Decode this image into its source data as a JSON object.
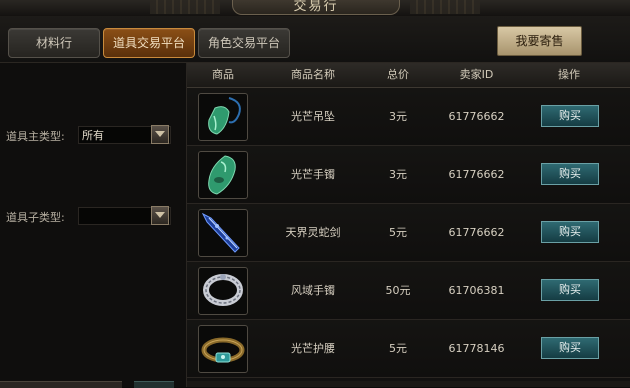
{
  "window": {
    "title": "交易行"
  },
  "tabs": [
    {
      "label": "材料行",
      "active": false
    },
    {
      "label": "道具交易平台",
      "active": true
    },
    {
      "label": "角色交易平台",
      "active": false
    }
  ],
  "sell_button": "我要寄售",
  "filters": {
    "main_type_label": "道具主类型:",
    "main_type_value": "所有",
    "sub_type_label": "道具子类型:",
    "sub_type_value": ""
  },
  "table": {
    "headers": [
      "商品",
      "商品名称",
      "总价",
      "卖家ID",
      "操作"
    ],
    "rows": [
      {
        "name": "光芒吊坠",
        "price": "3元",
        "seller": "61776662",
        "action": "购买",
        "icon": "jade-pendant-icon"
      },
      {
        "name": "光芒手镯",
        "price": "3元",
        "seller": "61776662",
        "action": "购买",
        "icon": "jade-bracelet-icon"
      },
      {
        "name": "天界灵蛇剑",
        "price": "5元",
        "seller": "61776662",
        "action": "购买",
        "icon": "blue-serpent-sword-icon"
      },
      {
        "name": "风域手镯",
        "price": "50元",
        "seller": "61706381",
        "action": "购买",
        "icon": "silver-bracelet-icon"
      },
      {
        "name": "光芒护腰",
        "price": "5元",
        "seller": "61778146",
        "action": "购买",
        "icon": "jade-belt-icon"
      }
    ]
  },
  "colors": {
    "active_tab": "#8b4f16",
    "buy_button": "#2f6a72",
    "sell_button": "#d8c8a5"
  }
}
